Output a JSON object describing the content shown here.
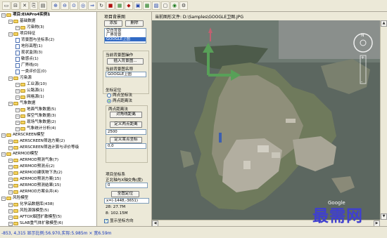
{
  "toolbar": {
    "icons": [
      "new-icon",
      "open-icon",
      "close-icon",
      "bookmark-icon",
      "print-icon",
      "zoom-in-icon",
      "zoom-out-icon",
      "zoom-window-icon",
      "zoom-full-icon",
      "pan-icon",
      "refresh-icon",
      "layer-icon",
      "table-icon",
      "chart-icon",
      "export-icon",
      "help-icon",
      "image-icon",
      "monitor-icon",
      "globe-icon",
      "settings-icon"
    ]
  },
  "tree": {
    "items": [
      {
        "label": "项目:EIAPro4实例1",
        "level": 0,
        "kind": "root"
      },
      {
        "label": "基础数据",
        "level": 1,
        "kind": "folder"
      },
      {
        "label": "污染物(3)",
        "level": 2,
        "kind": "folder"
      },
      {
        "label": "项目特征",
        "level": 1,
        "kind": "folder"
      },
      {
        "label": "背景图与坐标系(2)",
        "level": 2,
        "kind": "doc"
      },
      {
        "label": "地形高程(1)",
        "level": 2,
        "kind": "doc"
      },
      {
        "label": "现状监测(3)",
        "level": 2,
        "kind": "doc"
      },
      {
        "label": "敏感点(1)",
        "level": 2,
        "kind": "doc"
      },
      {
        "label": "厂界线(0)",
        "level": 2,
        "kind": "doc"
      },
      {
        "label": "一类评价区(0)",
        "level": 2,
        "kind": "doc"
      },
      {
        "label": "污染源",
        "level": 1,
        "kind": "folder"
      },
      {
        "label": "工业源(10)",
        "level": 2,
        "kind": "folder"
      },
      {
        "label": "公路源(1)",
        "level": 2,
        "kind": "folder"
      },
      {
        "label": "网格源(1)",
        "level": 2,
        "kind": "folder"
      },
      {
        "label": "气象数据",
        "level": 1,
        "kind": "folder"
      },
      {
        "label": "地面气象数据(5)",
        "level": 2,
        "kind": "folder"
      },
      {
        "label": "探空气象数据(3)",
        "level": 2,
        "kind": "folder"
      },
      {
        "label": "现场气象数据(2)",
        "level": 2,
        "kind": "folder"
      },
      {
        "label": "气象统计分析(4)",
        "level": 2,
        "kind": "folder"
      },
      {
        "label": "AERSCREEN模型",
        "level": 0,
        "kind": "folder"
      },
      {
        "label": "AERSCREEN筛选方案(2)",
        "level": 1,
        "kind": "folder"
      },
      {
        "label": "AERSCREEN筛选计算与评价等级",
        "level": 1,
        "kind": "folder"
      },
      {
        "label": "AERMOD模型",
        "level": 0,
        "kind": "folder"
      },
      {
        "label": "AERMOD预测气象(7)",
        "level": 1,
        "kind": "folder"
      },
      {
        "label": "AERMOD预测点(2)",
        "level": 1,
        "kind": "folder"
      },
      {
        "label": "AERMOD建筑物下洗(2)",
        "level": 1,
        "kind": "folder"
      },
      {
        "label": "AERMOD预测方案(15)",
        "level": 1,
        "kind": "folder"
      },
      {
        "label": "AERMOD预测结果(15)",
        "level": 1,
        "kind": "folder"
      },
      {
        "label": "AERMOD方案合并(4)",
        "level": 1,
        "kind": "folder"
      },
      {
        "label": "风险模型",
        "level": 0,
        "kind": "folder"
      },
      {
        "label": "化学品数据库(438)",
        "level": 1,
        "kind": "folder"
      },
      {
        "label": "风险源强模型(5)",
        "level": 1,
        "kind": "folder"
      },
      {
        "label": "AFTOX烟团扩散模型(5)",
        "level": 1,
        "kind": "folder"
      },
      {
        "label": "SLAB重气体扩散模型(6)",
        "level": 1,
        "kind": "folder"
      }
    ]
  },
  "panel": {
    "title": "项目背景图",
    "add_label": "添加",
    "delete_label": "删除",
    "bg_list": [
      "空白背景",
      "厂界背景",
      "GOOGLE卫图"
    ],
    "bg_selected": 2,
    "ops_title": "当前背景图操作",
    "insert_label": "插入背景图...",
    "name_label": "当前背景图名称",
    "name_value": "GOOGLE卫图",
    "coord_title": "坐标定位",
    "radio_two_axes": "两点坐标法",
    "radio_two_points": "两点距离法",
    "dist_group": "两点距离法",
    "diag_btn": "对角线距离",
    "define_two_btn": "定义两点距离",
    "dist_value": "2500",
    "define_origin_btn": "定义某点坐标",
    "origin_value": "0,0",
    "proj_title": "项目坐标系",
    "north_label": "正北轴与X轴交角(度)",
    "north_value": "0",
    "locate_btn": "全图定位",
    "coord_readout": "x=(-1448,-3651)",
    "zoom_x": "28: 27.7M",
    "zoom_y": "8: 102.15M",
    "show_north": "显示坐标方向"
  },
  "map": {
    "path_label": "当前图形文件: D:\\Samples\\GOOGLE卫图.JPG",
    "axis_y_color": "#58a058",
    "axis_x_color": "#c06070"
  },
  "watermark": "最需网",
  "status": {
    "text": "-853, 4,315 显示比例:56.970,实际:5.985m × 宽6.59m"
  }
}
